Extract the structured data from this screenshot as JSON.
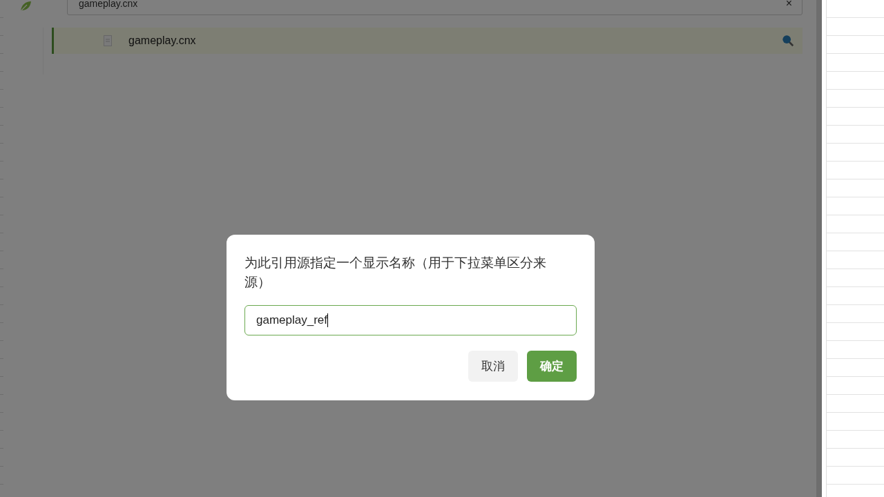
{
  "source_field": {
    "value": "gameplay.cnx",
    "clear": "×"
  },
  "file_list": [
    {
      "name": "gameplay.cnx",
      "selected": true
    }
  ],
  "dialog": {
    "message": "为此引用源指定一个显示名称（用于下拉菜单区分来源）",
    "input": {
      "value": "gameplay_ref",
      "focused": true
    },
    "buttons": [
      {
        "label": "取消",
        "kind": "secondary"
      },
      {
        "label": "确定",
        "kind": "primary"
      }
    ]
  }
}
